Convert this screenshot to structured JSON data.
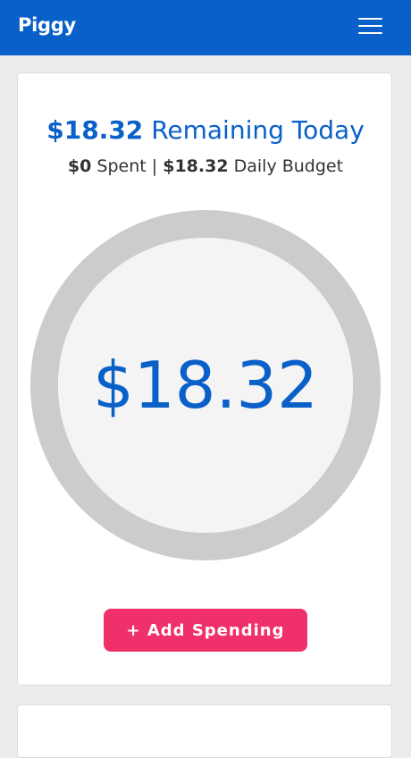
{
  "app": {
    "brand": "Piggy"
  },
  "summary": {
    "remaining_amount": "$18.32",
    "remaining_label": "Remaining Today",
    "spent_amount": "$0",
    "spent_label": "Spent",
    "separator": "|",
    "budget_amount": "$18.32",
    "budget_label": "Daily Budget"
  },
  "gauge": {
    "center_amount": "$18.32",
    "spent_fraction": 0,
    "track_color": "#cccccc",
    "inner_color": "#f4f4f4"
  },
  "actions": {
    "add_spending_label": "+ Add Spending"
  },
  "colors": {
    "primary": "#0960c8",
    "accent": "#f0306a",
    "background": "#ebecee"
  }
}
